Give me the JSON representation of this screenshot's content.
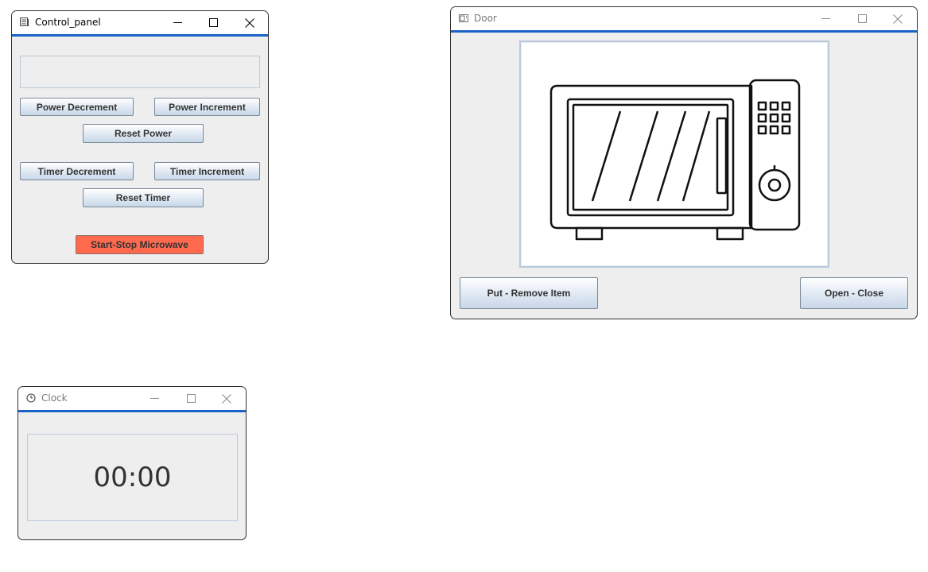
{
  "control_panel": {
    "title": "Control_panel",
    "display_value": "",
    "buttons": {
      "power_decrement": "Power Decrement",
      "power_increment": "Power Increment",
      "reset_power": "Reset Power",
      "timer_decrement": "Timer Decrement",
      "timer_increment": "Timer Increment",
      "reset_timer": "Reset Timer",
      "start_stop": "Start-Stop Microwave"
    }
  },
  "door": {
    "title": "Door",
    "image": "microwave-oven-icon",
    "buttons": {
      "put_remove": "Put - Remove Item",
      "open_close": "Open - Close"
    }
  },
  "clock": {
    "title": "Clock",
    "time": "00:00"
  },
  "colors": {
    "accent": "#1a63c6",
    "start_stop_button": "#ff6a4f",
    "window_background": "#eeeeee"
  }
}
